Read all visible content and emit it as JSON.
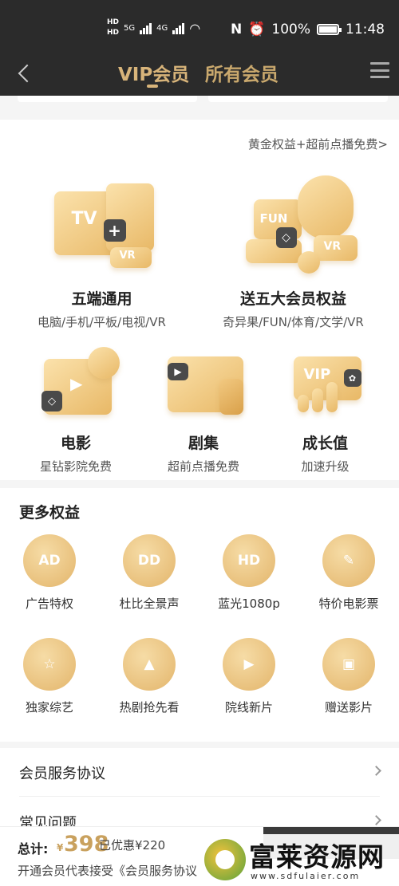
{
  "status_bar": {
    "hd1": "HD",
    "hd2": "HD",
    "net1": "5G",
    "net2": "4G",
    "battery": "100%",
    "time": "11:48"
  },
  "nav": {
    "tab_vip": "VIP会员",
    "tab_all": "所有会员"
  },
  "benefits": {
    "link": "黄金权益+超前点播免费>",
    "items": [
      {
        "title": "五端通用",
        "sub": "电脑/手机/平板/电视/VR"
      },
      {
        "title": "送五大会员权益",
        "sub": "奇异果/FUN/体育/文学/VR"
      },
      {
        "title": "电影",
        "sub": "星钻影院免费"
      },
      {
        "title": "剧集",
        "sub": "超前点播免费"
      },
      {
        "title": "成长值",
        "sub": "加速升级"
      }
    ],
    "illus_text": {
      "tv": "TV",
      "vr": "VR",
      "fun": "FUN",
      "vip": "VIP"
    }
  },
  "more": {
    "title": "更多权益",
    "items": [
      {
        "label": "广告特权",
        "glyph": "AD",
        "icon": "no-ad-icon"
      },
      {
        "label": "杜比全景声",
        "glyph": "DD",
        "icon": "dolby-icon"
      },
      {
        "label": "蓝光1080p",
        "glyph": "HD",
        "icon": "hd-icon"
      },
      {
        "label": "特价电影票",
        "glyph": "✎",
        "icon": "ticket-icon"
      },
      {
        "label": "独家综艺",
        "glyph": "☆",
        "icon": "star-icon"
      },
      {
        "label": "热剧抢先看",
        "glyph": "▲",
        "icon": "fire-icon"
      },
      {
        "label": "院线新片",
        "glyph": "▶",
        "icon": "film-icon"
      },
      {
        "label": "赠送影片",
        "glyph": "▣",
        "icon": "gift-icon"
      }
    ]
  },
  "links": [
    {
      "label": "会员服务协议"
    },
    {
      "label": "常见问题"
    }
  ],
  "bottom": {
    "total_label": "总计:",
    "currency": "¥",
    "price": "398",
    "discount": "已优惠¥220",
    "agreement": "开通会员代表接受《会员服务协议"
  },
  "watermark": {
    "title": "富莱资源网",
    "sub": "www.sdfulaier.com"
  }
}
